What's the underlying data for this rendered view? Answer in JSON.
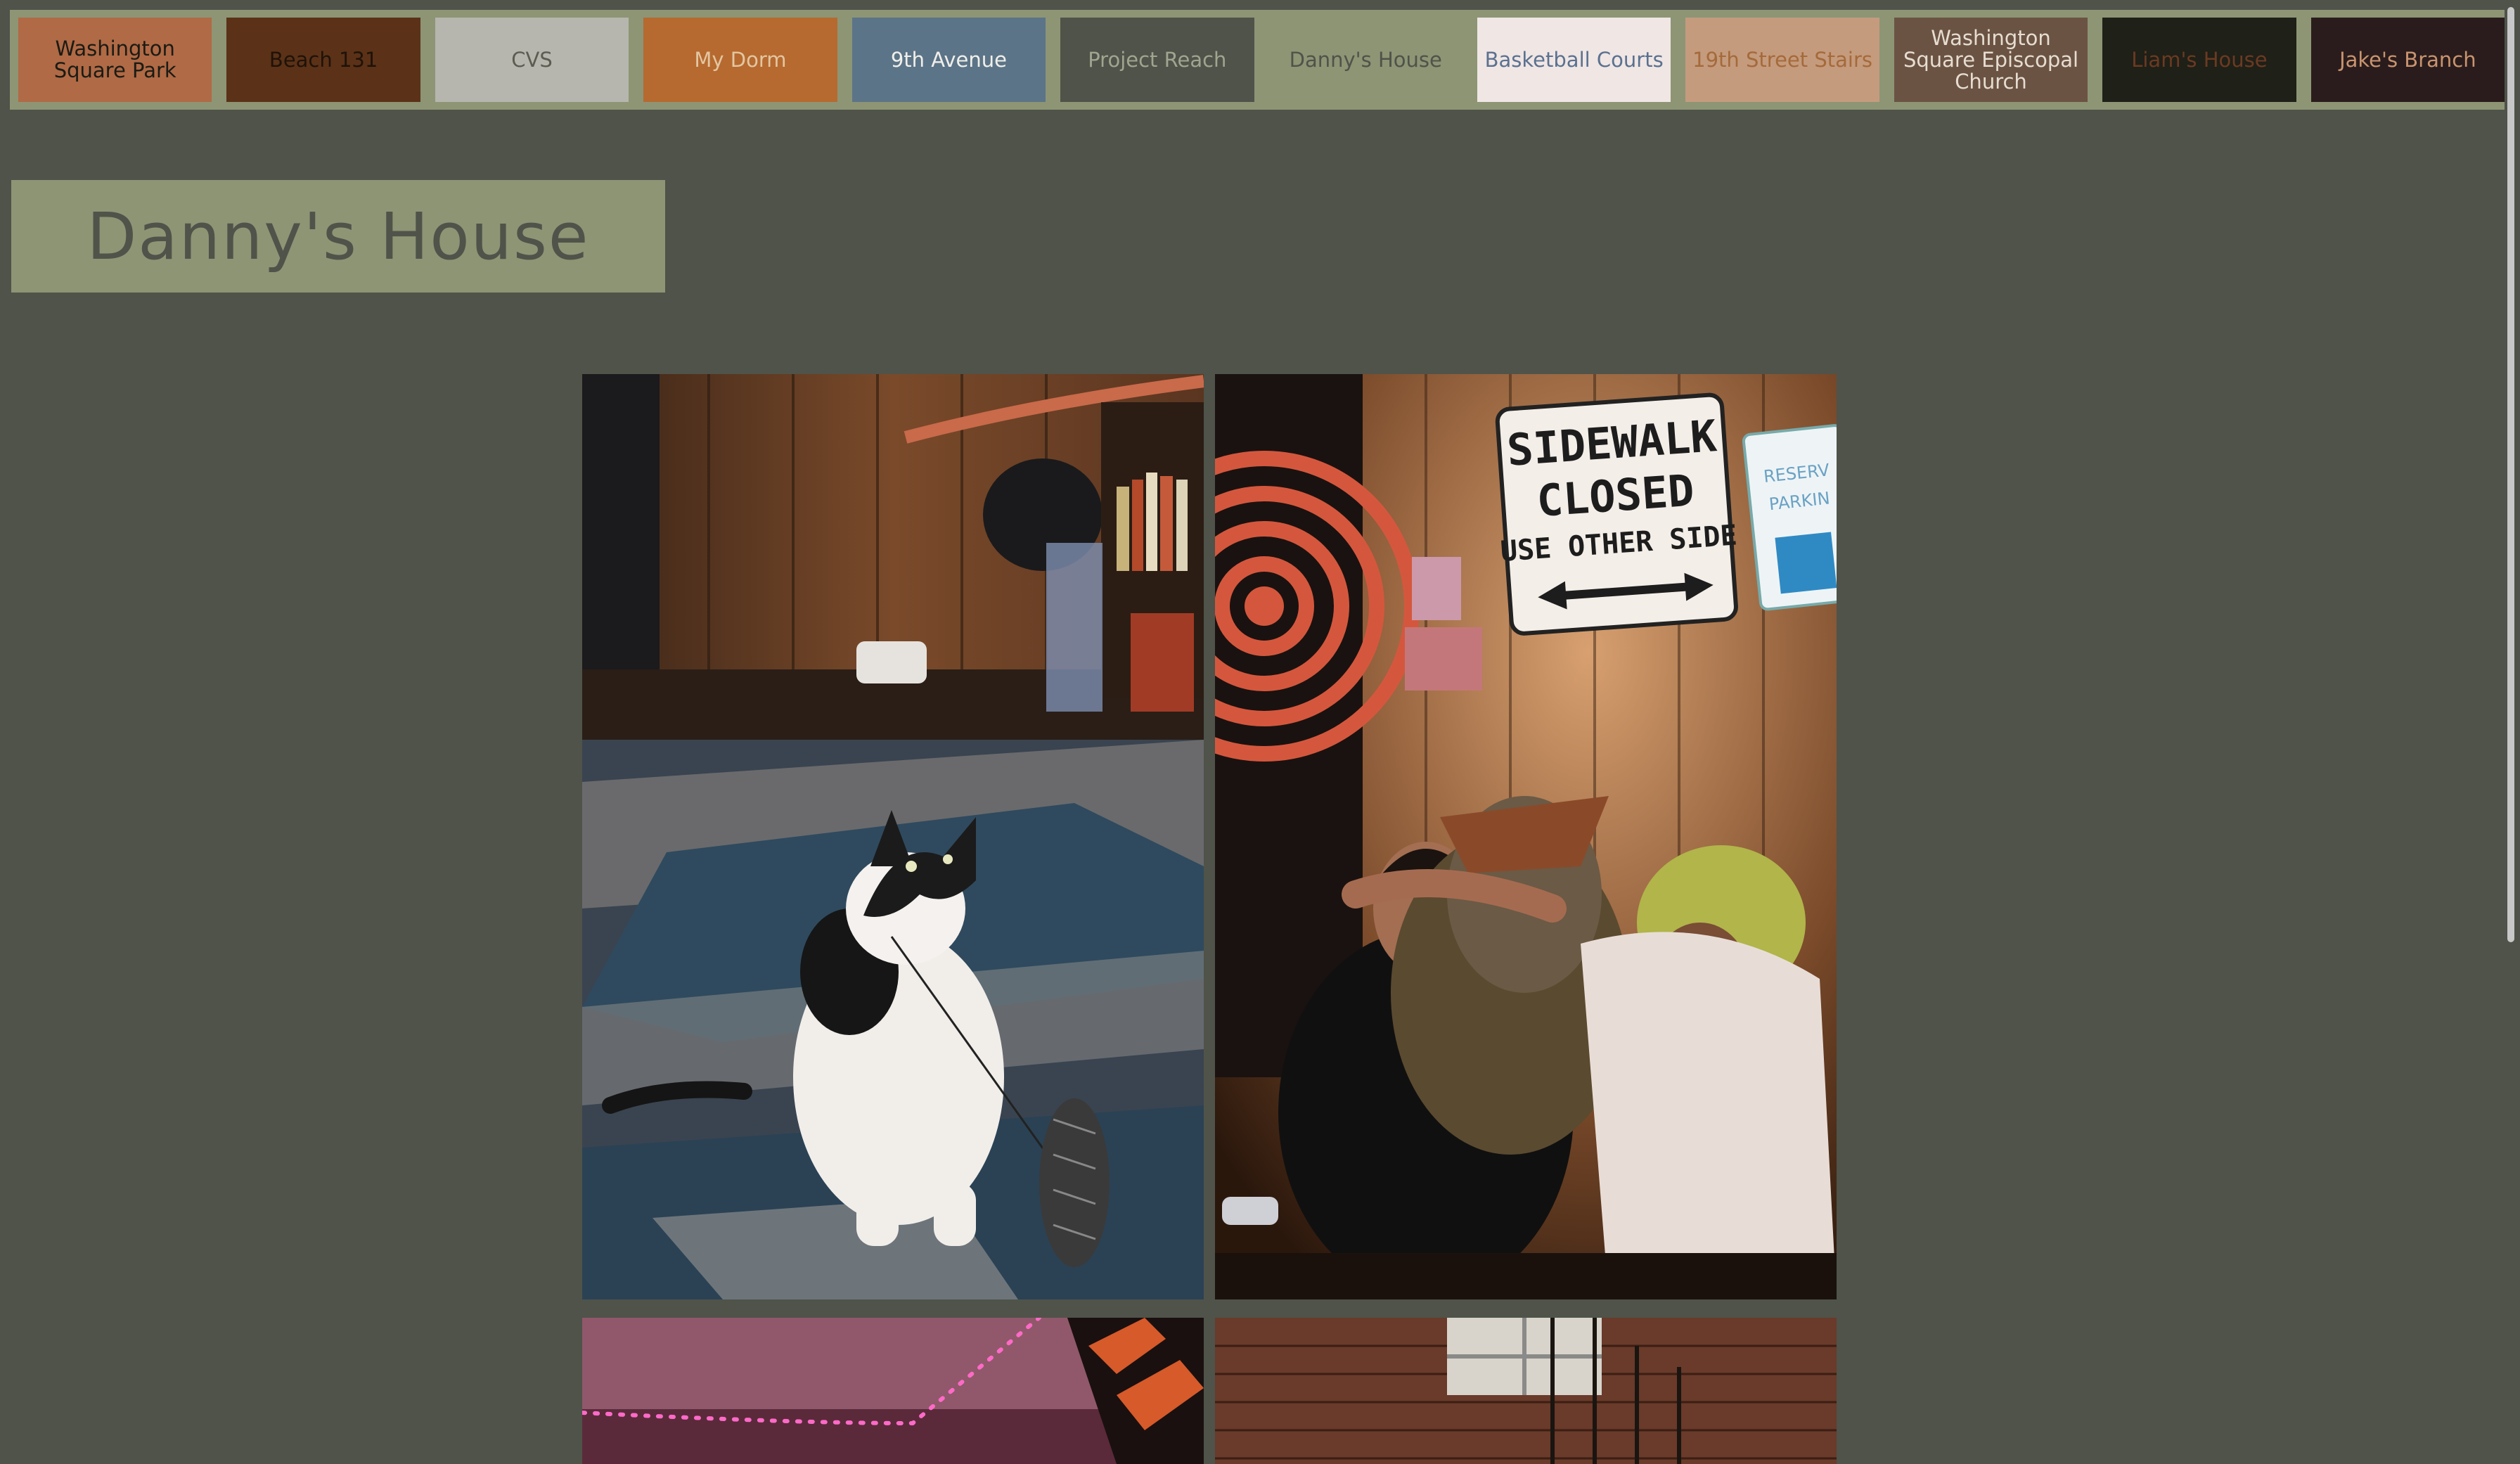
{
  "nav": {
    "items": [
      {
        "label": "Washington Square Park",
        "bg": "#b06a45",
        "fg": "#1b1b15"
      },
      {
        "label": "Beach 131",
        "bg": "#5b3217",
        "fg": "#1f120a"
      },
      {
        "label": "CVS",
        "bg": "#b6b6ae",
        "fg": "#5c5c52"
      },
      {
        "label": "My Dorm",
        "bg": "#b66a2f",
        "fg": "#e3c6a2"
      },
      {
        "label": "9th Avenue",
        "bg": "#5c7488",
        "fg": "#f0efe9"
      },
      {
        "label": "Project Reach",
        "bg": "#4f5349",
        "fg": "#9fa58f"
      },
      {
        "label": "Danny's House",
        "bg": "#8d9575",
        "fg": "#4f5349"
      },
      {
        "label": "Basketball Courts",
        "bg": "#f0e6e4",
        "fg": "#5a7190"
      },
      {
        "label": "19th Street Stairs",
        "bg": "#c59b7e",
        "fg": "#a56a3a"
      },
      {
        "label": "Washington Square Episcopal Church",
        "bg": "#6b5343",
        "fg": "#e6ddd1"
      },
      {
        "label": "Liam's House",
        "bg": "#1f2017",
        "fg": "#6b3a22"
      },
      {
        "label": "Jake's Branch",
        "bg": "#2a1c1c",
        "fg": "#c9946f"
      }
    ]
  },
  "page": {
    "title": "Danny's House"
  },
  "gallery": {
    "photo1": {
      "sign_line1": "SIDEWALK",
      "sign_line2": "CLOSED",
      "sign_line3": "USE OTHER SIDE",
      "parking_line1": "RESERV",
      "parking_line2": "PARKIN"
    }
  },
  "colors": {
    "background": "#4f5349",
    "accent": "#8d9575"
  }
}
